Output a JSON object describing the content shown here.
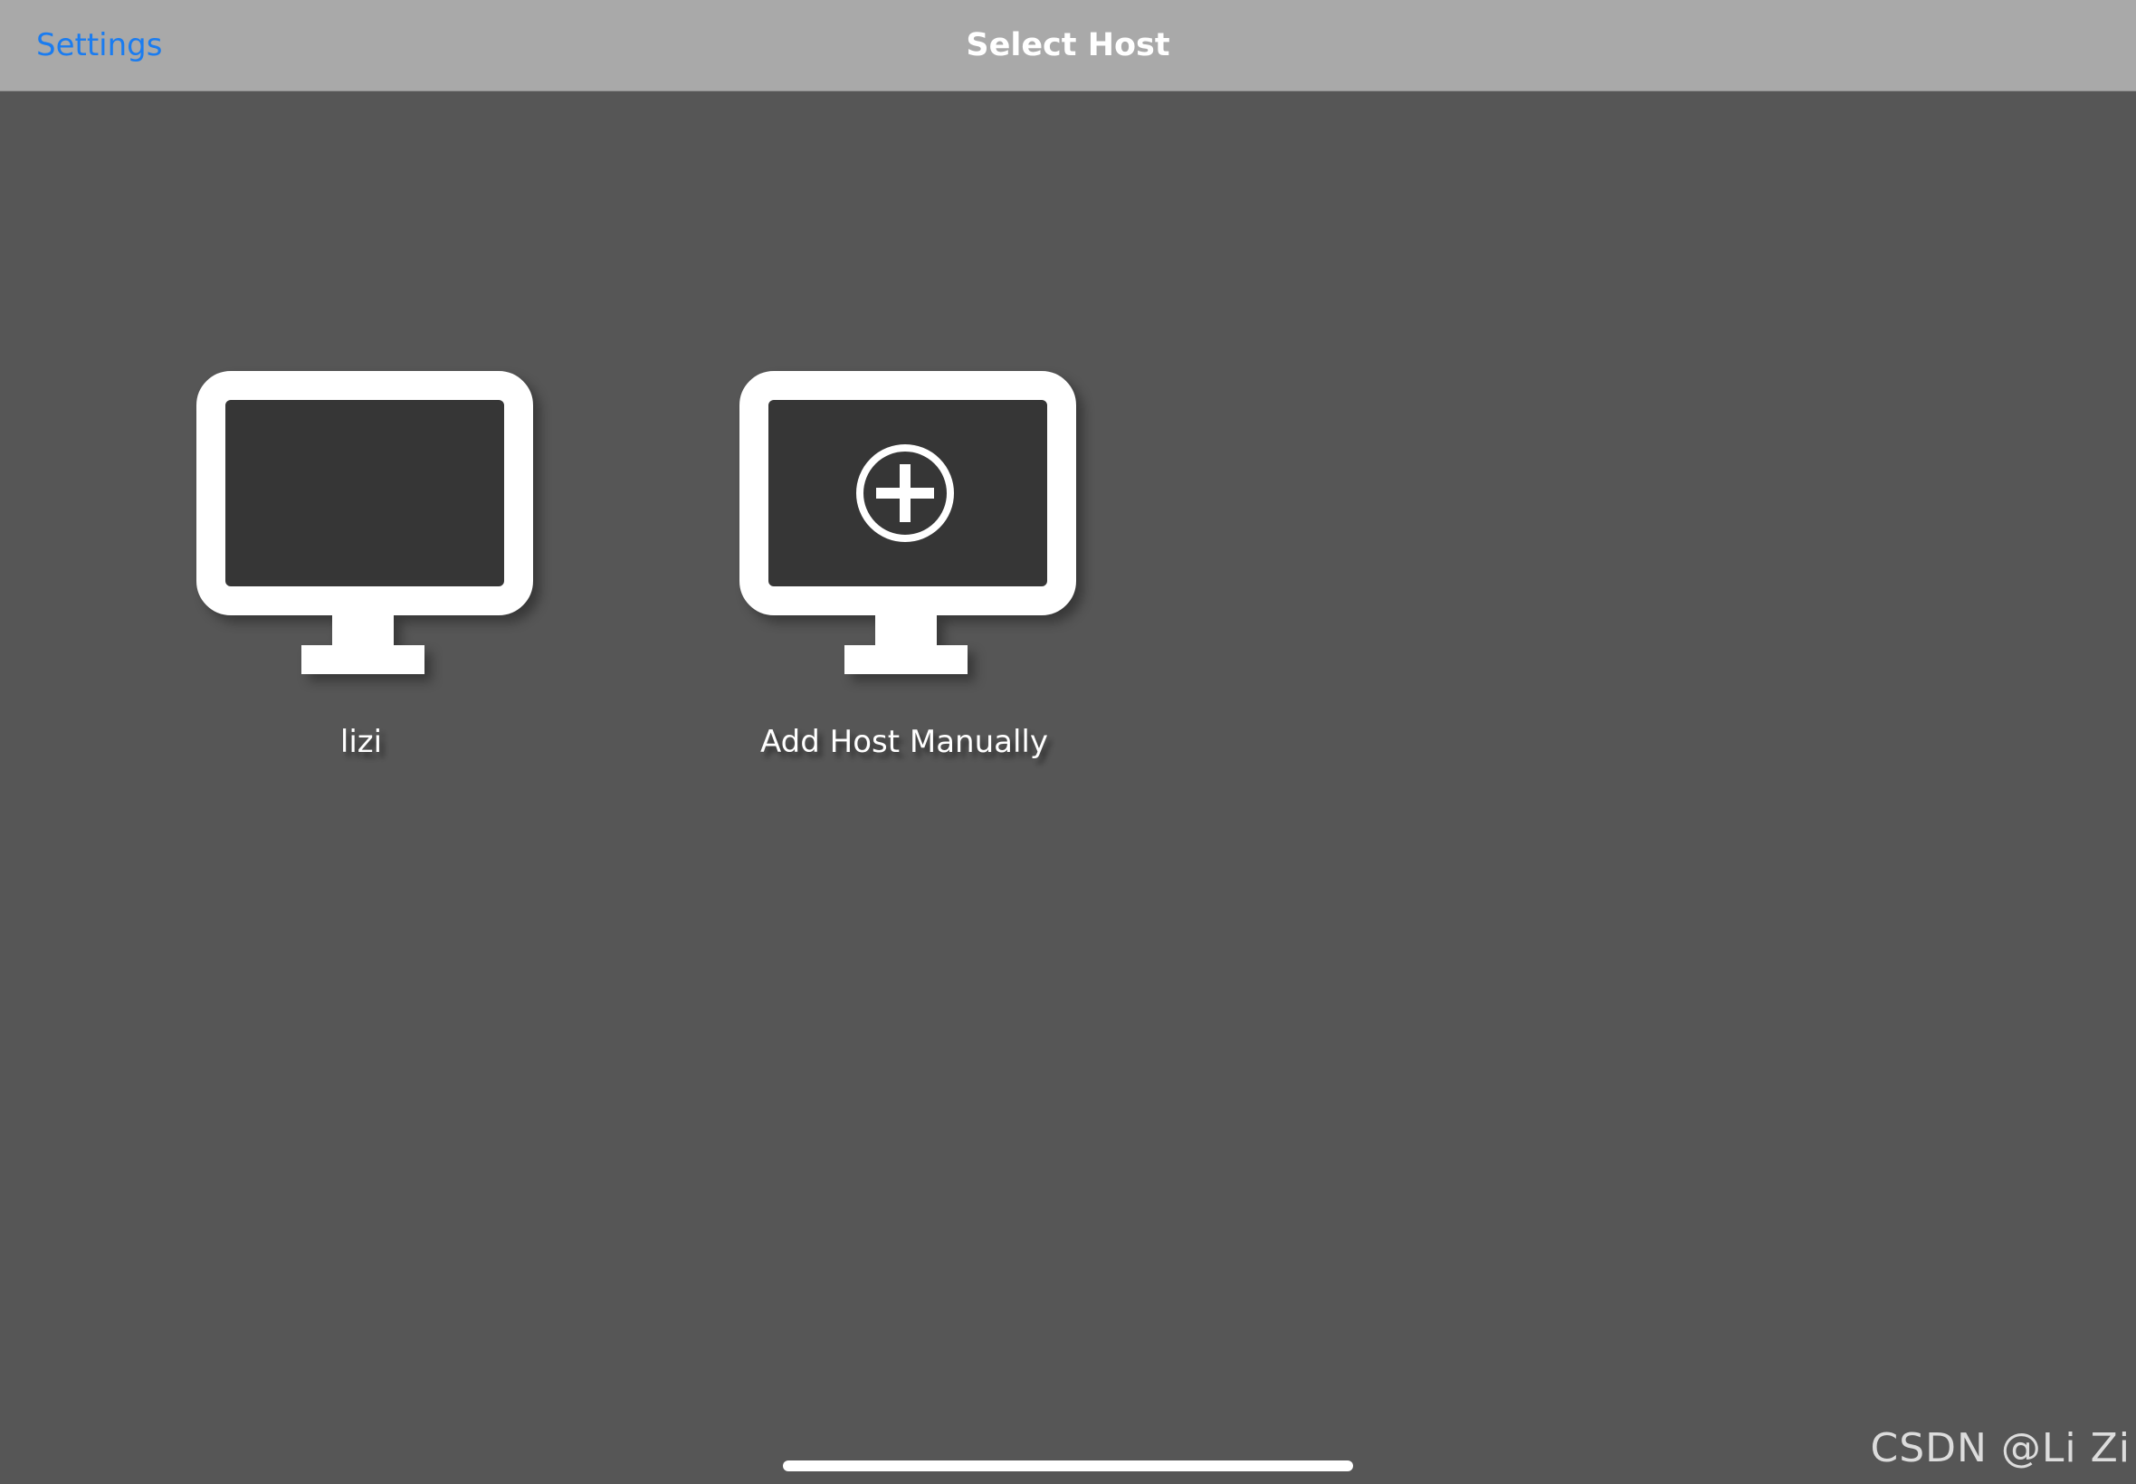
{
  "navbar": {
    "left_button": "Settings",
    "title": "Select Host",
    "accent_color": "#1a7cf0"
  },
  "hosts": [
    {
      "label": "lizi",
      "icon": "monitor-icon"
    },
    {
      "label": "Add Host Manually",
      "icon": "monitor-add-icon"
    }
  ],
  "watermark": "CSDN @Li Zi",
  "colors": {
    "background": "#565656",
    "navbar": "#a9a9a9",
    "screen_inner": "#363636",
    "icon": "#ffffff"
  }
}
